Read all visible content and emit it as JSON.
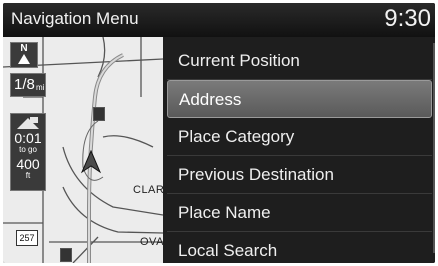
{
  "header": {
    "title": "Navigation Menu",
    "time": "9:30"
  },
  "map": {
    "compass_label": "N",
    "scale_value": "1/8",
    "scale_unit": "mi",
    "eta_value": "0:01",
    "eta_label": "to go",
    "distance_value": "400",
    "distance_unit": "ft",
    "route_shield": "257",
    "street_label_1": "CLAR",
    "street_label_2": "OVA"
  },
  "menu": {
    "items": [
      {
        "label": "Current Position"
      },
      {
        "label": "Address"
      },
      {
        "label": "Place Category"
      },
      {
        "label": "Previous Destination"
      },
      {
        "label": "Place Name"
      },
      {
        "label": "Local Search"
      }
    ],
    "selected_label": "Address"
  }
}
